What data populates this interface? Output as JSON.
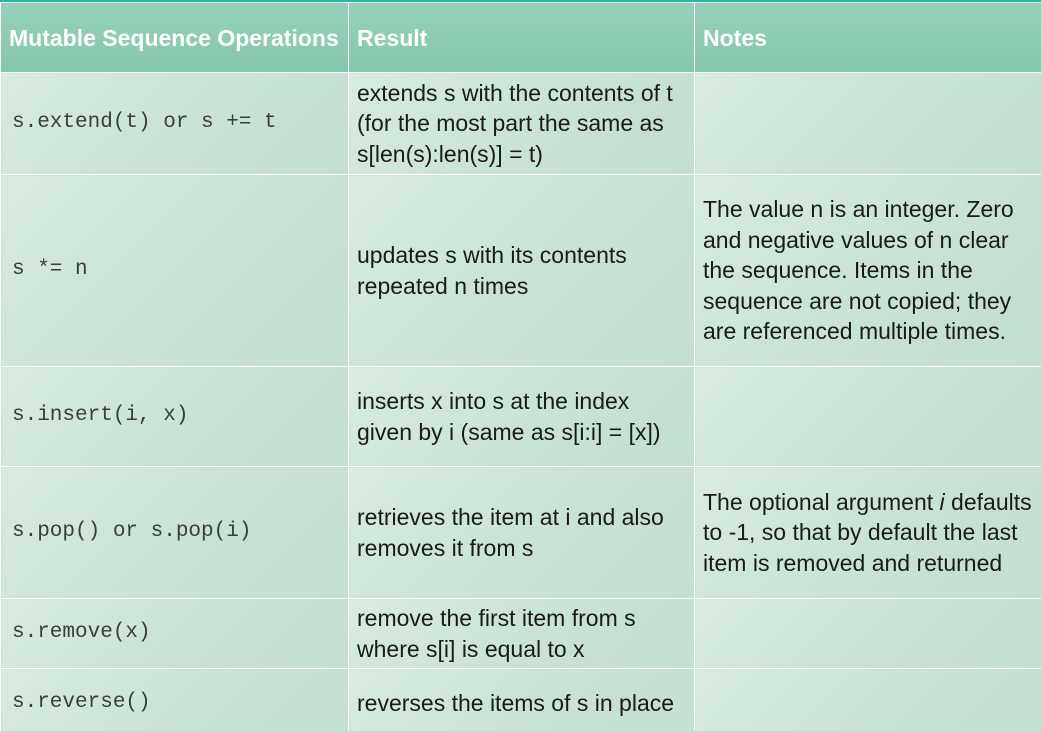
{
  "headers": {
    "operation": "Mutable Sequence Operations",
    "result": "Result",
    "notes": "Notes"
  },
  "rows": [
    {
      "operation": "s.extend(t) or s += t",
      "result": "extends s with the contents of t (for the most part the same as s[len(s):len(s)] = t)",
      "notes": ""
    },
    {
      "operation": "s *= n",
      "result": "updates s with its contents repeated n times",
      "notes": "The value n is an integer. Zero and negative values of n clear the sequence. Items in the sequence are not copied; they are referenced multiple times."
    },
    {
      "operation": "s.insert(i, x)",
      "result": "inserts x into s at the index given by i (same as s[i:i] = [x])",
      "notes": ""
    },
    {
      "operation": "s.pop() or s.pop(i)",
      "result": "retrieves the item at i and also removes it from s",
      "notes_before": "The optional argument ",
      "notes_em": "i",
      "notes_after": " defaults to -1, so that by default the last item is removed and returned"
    },
    {
      "operation": "s.remove(x)",
      "result": "remove the first item from s where s[i] is equal to x",
      "notes": ""
    },
    {
      "operation": "s.reverse()",
      "result": "reverses the items of s in place",
      "notes": ""
    }
  ],
  "colors": {
    "header_bg": "#8ccbb2",
    "cell_bg": "#cfe6da",
    "top_rule": "#2cb5a3"
  }
}
